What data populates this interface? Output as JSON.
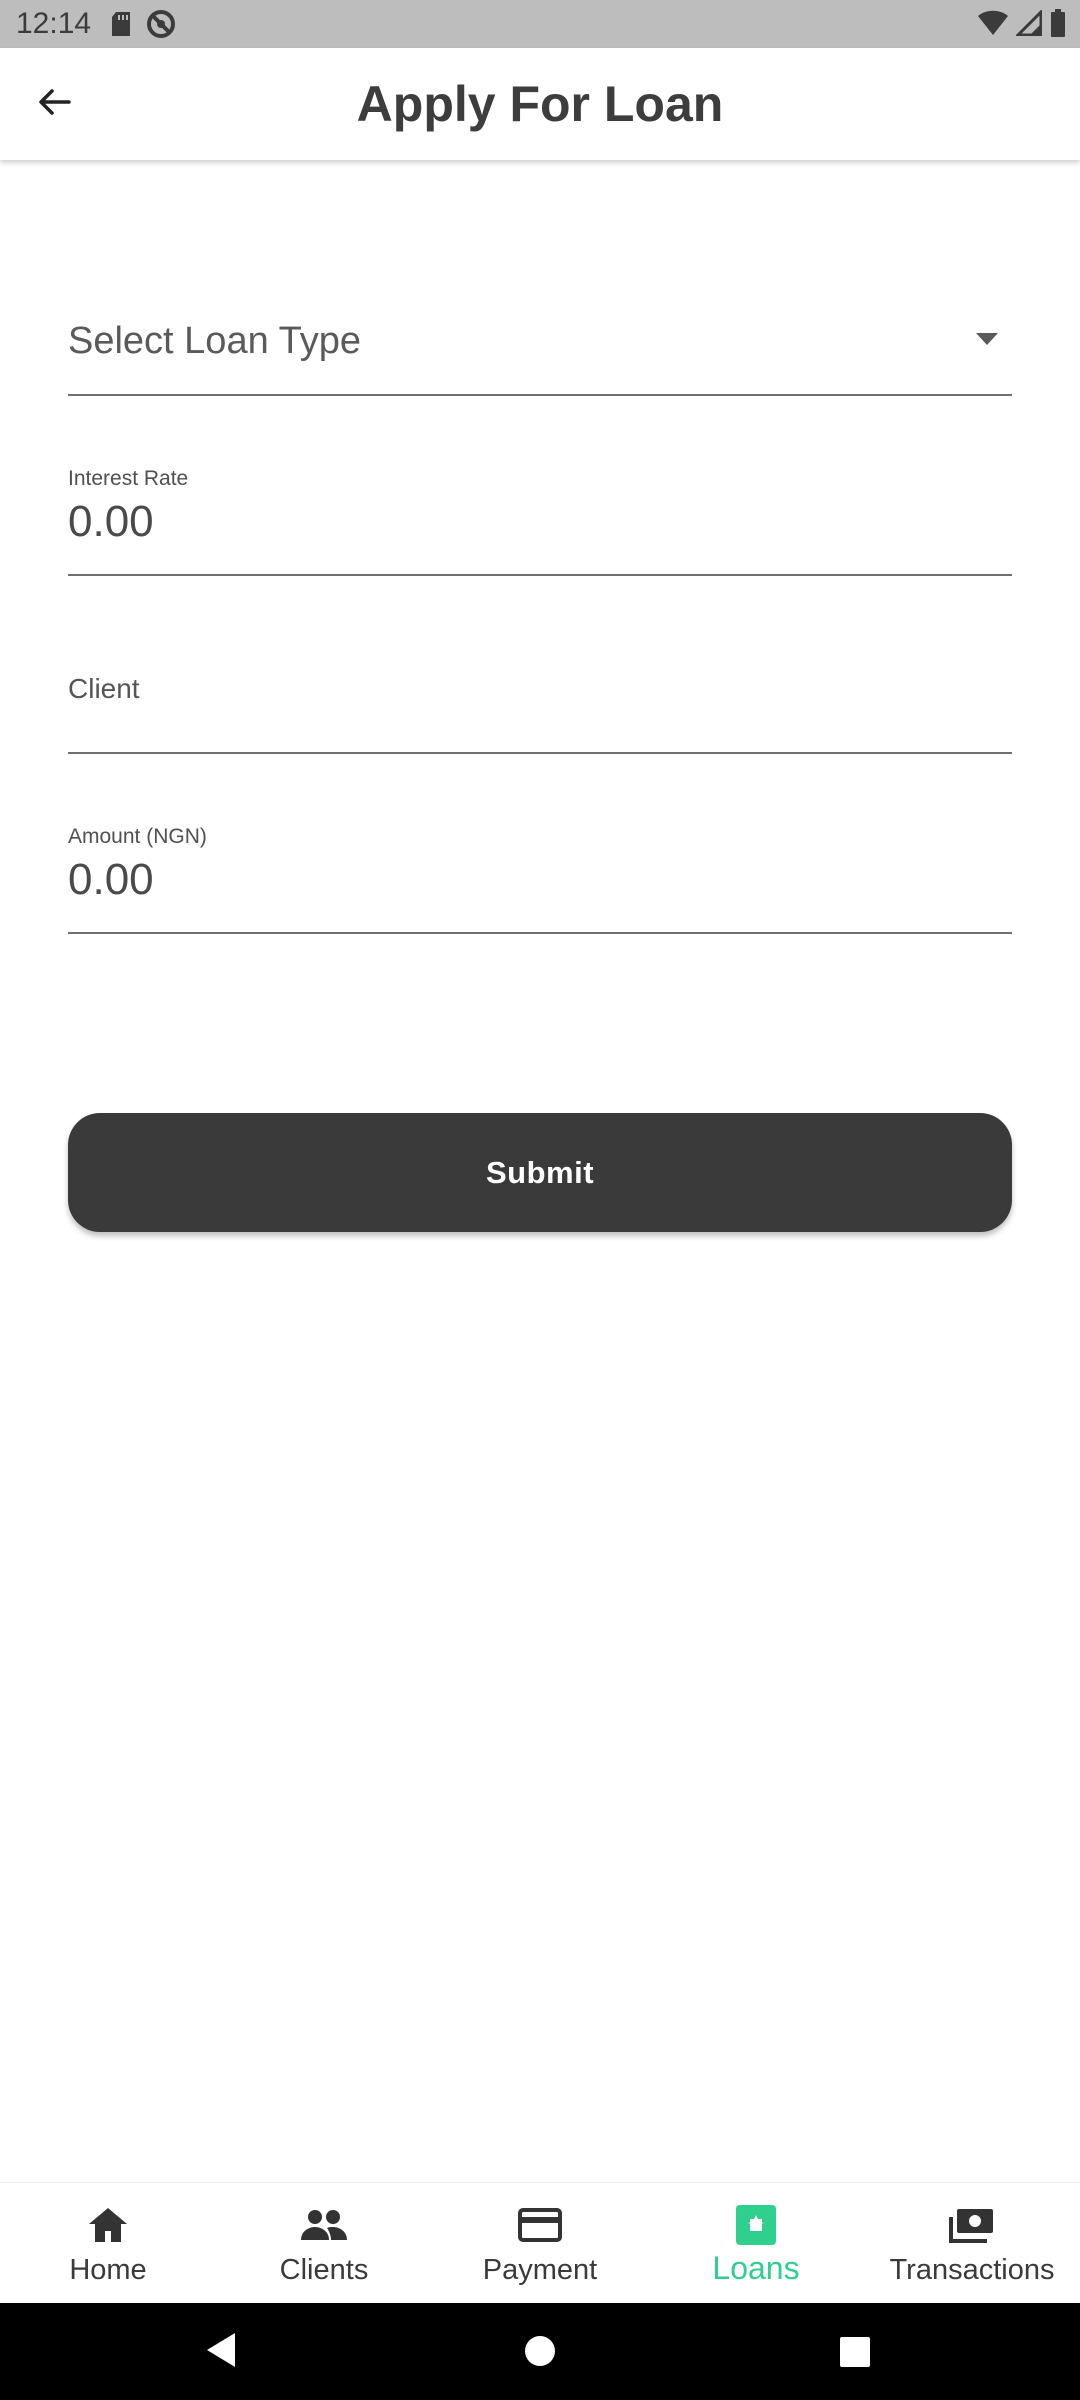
{
  "status_bar": {
    "time": "12:14",
    "left_icons": [
      "sd-card-icon",
      "do-not-disturb-icon"
    ],
    "right_icons": [
      "wifi-icon",
      "signal-icon",
      "battery-icon"
    ]
  },
  "app_bar": {
    "title": "Apply For Loan",
    "back_icon": "arrow-back-icon"
  },
  "form": {
    "loan_type": {
      "placeholder": "Select Loan Type",
      "icon": "dropdown-arrow-icon"
    },
    "interest_rate": {
      "label": "Interest Rate",
      "value": "0.00"
    },
    "client": {
      "label": "Client",
      "value": ""
    },
    "amount": {
      "label": "Amount (NGN)",
      "value": "0.00"
    },
    "submit_label": "Submit"
  },
  "bottom_nav": {
    "items": [
      {
        "label": "Home",
        "icon": "home-icon",
        "active": false
      },
      {
        "label": "Clients",
        "icon": "people-icon",
        "active": false
      },
      {
        "label": "Payment",
        "icon": "credit-card-icon",
        "active": false
      },
      {
        "label": "Loans",
        "icon": "loans-icon",
        "active": true
      },
      {
        "label": "Transactions",
        "icon": "money-icon",
        "active": false
      }
    ]
  },
  "colors": {
    "accent": "#2fcf8e",
    "button_bg": "#3a3a3a",
    "status_bar": "#bdbdbd",
    "system_nav": "#000000"
  }
}
